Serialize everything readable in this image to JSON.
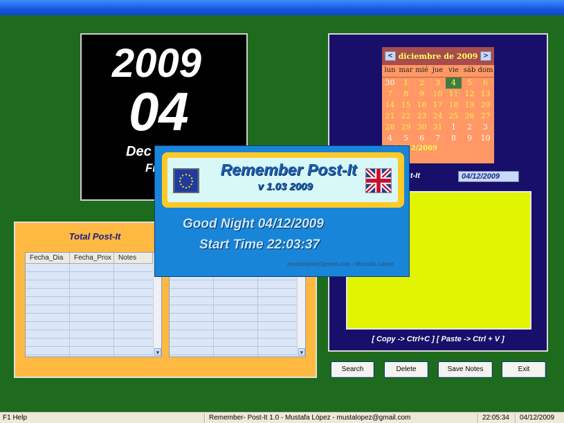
{
  "date_panel": {
    "year": "2009",
    "day": "04",
    "month": "Dec",
    "weekday": "Fr"
  },
  "total_panel": {
    "title": "Total Post-It",
    "columns": [
      "Fecha_Dia",
      "Fecha_Prox",
      "Notes"
    ]
  },
  "calendar": {
    "month_label": "diciembre de 2009",
    "prev_label": "<",
    "next_label": ">",
    "weekdays": [
      "lun",
      "mar",
      "mié",
      "jue",
      "vie",
      "sáb",
      "dom"
    ],
    "days": [
      "30",
      "1",
      "2",
      "3",
      "4",
      "5",
      "6",
      "7",
      "8",
      "9",
      "10",
      "11",
      "12",
      "13",
      "14",
      "15",
      "16",
      "17",
      "18",
      "19",
      "20",
      "21",
      "22",
      "23",
      "24",
      "25",
      "26",
      "27",
      "28",
      "29",
      "30",
      "31",
      "1",
      "2",
      "3",
      "4",
      "5",
      "6",
      "7",
      "8",
      "9",
      "10"
    ],
    "today_text": "y: 04/12/2009"
  },
  "notes_panel": {
    "postit_label": "ost-It",
    "date_value": "04/12/2009",
    "hint": "[ Copy ->  Ctrl+C ]  [ Paste -> Ctrl + V ]"
  },
  "buttons": {
    "search": "Search",
    "delete": "Delete",
    "save": "Save Notes",
    "exit": "Exit"
  },
  "splash": {
    "title": "Remember Post-It",
    "version": "v 1.03  2009",
    "greeting": "Good Night  04/12/2009",
    "start_time": "Start Time    22:03:37",
    "author": "mustalopez@gmail.com - Mustafa López"
  },
  "status_bar": {
    "help": "F1 Help",
    "app_info": "Remember- Post-It 1.0 - Mustafa López - mustalopez@gmail.com",
    "time": "22:05:34",
    "date": "04/12/2009"
  },
  "colors": {
    "background": "#1e6b1e",
    "notes": "#e1f500",
    "calendar": "#ff9865",
    "splash": "#1985d9"
  }
}
